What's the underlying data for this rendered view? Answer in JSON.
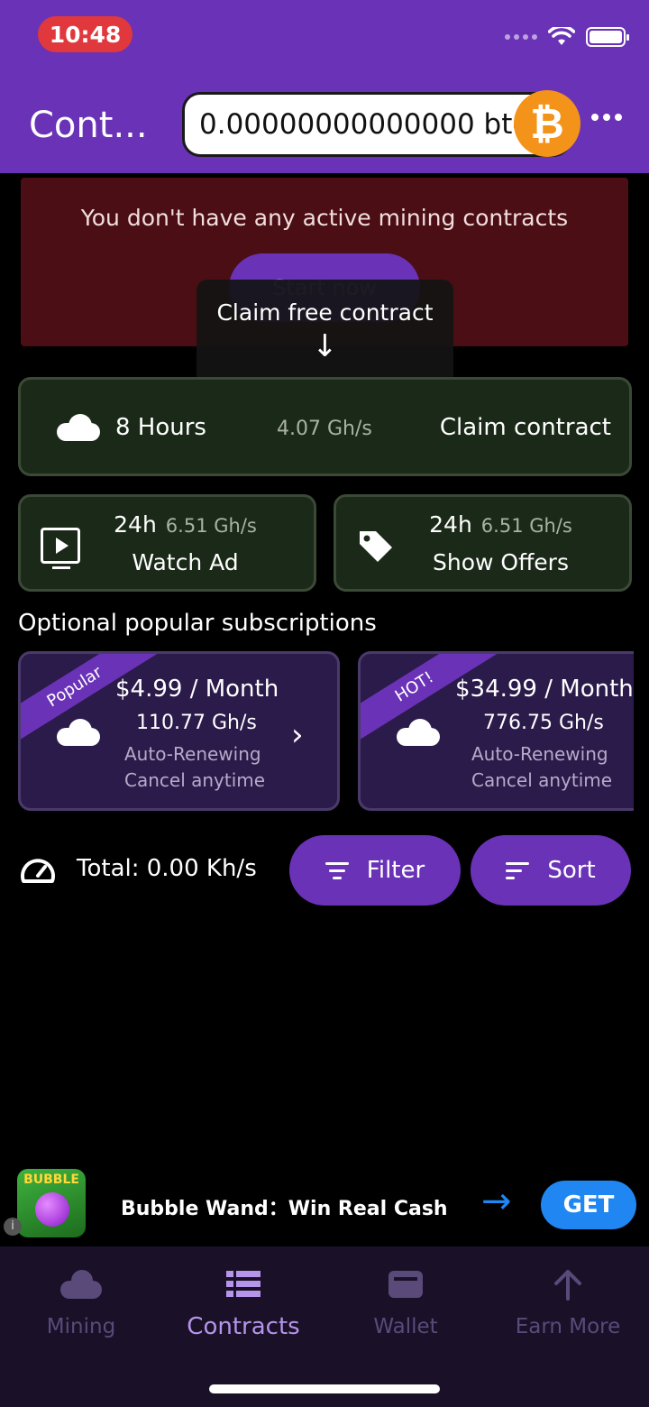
{
  "status_bar": {
    "time": "10:48"
  },
  "header": {
    "title": "Cont...",
    "btc_balance": "0.00000000000000 btc",
    "btc_symbol": "₿"
  },
  "notice": {
    "text": "You don't have any active mining contracts",
    "start_button": "Start now",
    "tooltip": "Claim free contract",
    "tooltip_arrow": "↓"
  },
  "free_contract": {
    "hours": "8 Hours",
    "speed": "4.07 Gh/s",
    "action": "Claim contract"
  },
  "watch_ad": {
    "hours": "24h",
    "speed": "6.51 Gh/s",
    "label": "Watch Ad"
  },
  "show_offers": {
    "hours": "24h",
    "speed": "6.51 Gh/s",
    "label": "Show Offers"
  },
  "subscriptions": {
    "title": "Optional popular subscriptions",
    "items": [
      {
        "badge": "Popular",
        "price": "$4.99 / Month",
        "speed": "110.77 Gh/s",
        "renew": "Auto-Renewing",
        "cancel": "Cancel anytime"
      },
      {
        "badge": "HOT!",
        "price": "$34.99 / Month",
        "speed": "776.75 Gh/s",
        "renew": "Auto-Renewing",
        "cancel": "Cancel anytime"
      }
    ],
    "next_glyph": "›"
  },
  "toolbar": {
    "total": "Total: 0.00 Kh/s",
    "filter": "Filter",
    "sort": "Sort"
  },
  "ad": {
    "icon_text": "BUBBLE",
    "info": "i",
    "title": "Bubble Wand：Win Real Cash",
    "arrow": "→",
    "get": "GET"
  },
  "nav": {
    "items": [
      {
        "label": "Mining",
        "icon": "cloud-icon"
      },
      {
        "label": "Contracts",
        "icon": "list-icon"
      },
      {
        "label": "Wallet",
        "icon": "wallet-icon"
      },
      {
        "label": "Earn More",
        "icon": "arrow-up-icon"
      }
    ],
    "active": "Contracts"
  },
  "colors": {
    "primary": "#6a32b7",
    "header_bg": "#6a32b7",
    "alert_bg": "#4a0e14",
    "card_green_bg": "#1b2a18",
    "card_purple_bg": "#2b1b4a",
    "bitcoin": "#f4931a",
    "get_button": "#1f86f2"
  }
}
